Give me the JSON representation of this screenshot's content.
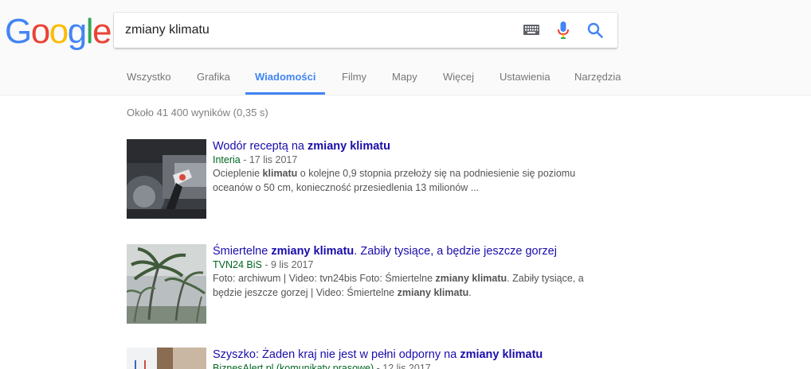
{
  "logo": {
    "letters": [
      "G",
      "o",
      "o",
      "g",
      "l",
      "e"
    ],
    "colors": [
      "#4285f4",
      "#ea4335",
      "#fbbc05",
      "#4285f4",
      "#34a853",
      "#ea4335"
    ]
  },
  "search": {
    "query": "zmiany klimatu"
  },
  "tabs": [
    {
      "label": "Wszystko"
    },
    {
      "label": "Grafika"
    },
    {
      "label": "Wiadomości",
      "active": true
    },
    {
      "label": "Filmy"
    },
    {
      "label": "Mapy"
    },
    {
      "label": "Więcej"
    },
    {
      "label": "Ustawienia"
    },
    {
      "label": "Narzędzia"
    }
  ],
  "stats": "Około 41 400 wyników (0,35 s)",
  "results": [
    {
      "title": [
        {
          "t": "Wodór receptą na ",
          "b": false
        },
        {
          "t": "zmiany klimatu",
          "b": true
        }
      ],
      "source": "Interia",
      "date": " - 17 lis 2017",
      "snippet": [
        {
          "t": "Ocieplenie ",
          "b": false
        },
        {
          "t": "klimatu",
          "b": true
        },
        {
          "t": " o kolejne 0,9 stopnia przełoży się na podniesienie się poziomu oceanów o 50 cm, konieczność przesiedlenia 13 milionów ...",
          "b": false
        }
      ],
      "thumb_icon": "car-refuel-thumbnail"
    },
    {
      "title": [
        {
          "t": "Śmiertelne ",
          "b": false
        },
        {
          "t": "zmiany klimatu",
          "b": true
        },
        {
          "t": ". Zabiły tysiące, a będzie jeszcze gorzej",
          "b": false
        }
      ],
      "source": "TVN24 BiS",
      "date": " - 9 lis 2017",
      "snippet": [
        {
          "t": "Foto: archiwum | Video: tvn24bis Foto: Śmiertelne ",
          "b": false
        },
        {
          "t": "zmiany klimatu",
          "b": true
        },
        {
          "t": ". Zabiły tysiące, a będzie jeszcze gorzej | Video: Śmiertelne ",
          "b": false
        },
        {
          "t": "zmiany klimatu",
          "b": true
        },
        {
          "t": ".",
          "b": false
        }
      ],
      "thumb_icon": "storm-palms-thumbnail"
    },
    {
      "title": [
        {
          "t": "Szyszko: Żaden kraj nie jest w pełni odporny na ",
          "b": false
        },
        {
          "t": "zmiany klimatu",
          "b": true
        }
      ],
      "source": "BiznesAlert.pl (komunikaty prasowe)",
      "date": " - 12 lis 2017",
      "snippet": [],
      "thumb_icon": "conference-thumbnail"
    }
  ]
}
